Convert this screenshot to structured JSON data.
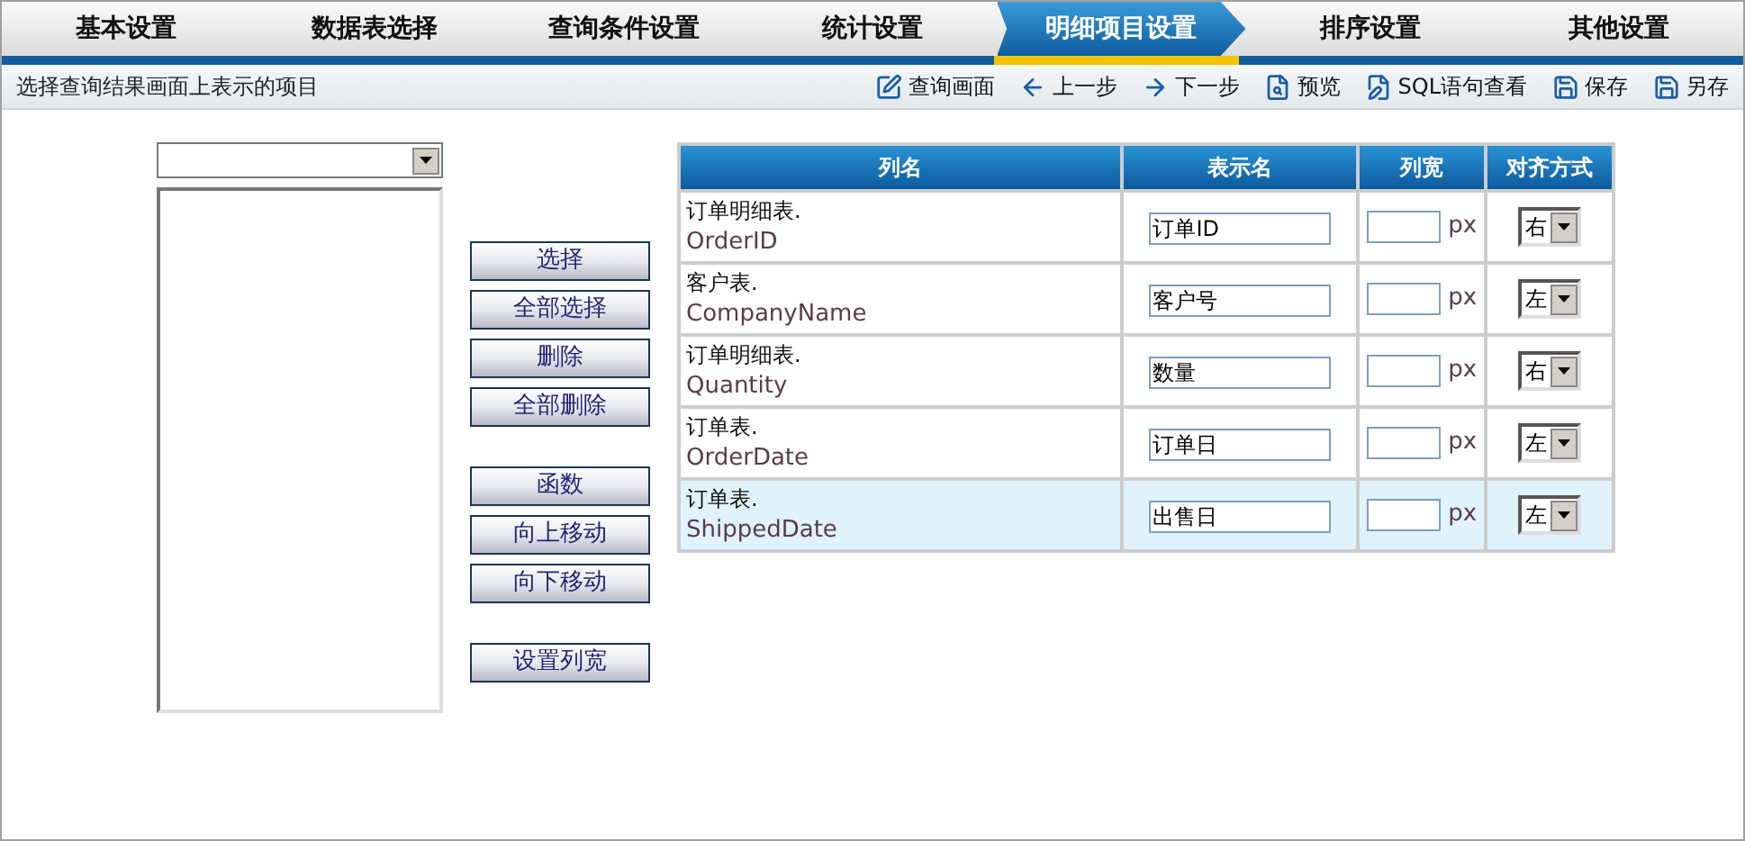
{
  "tabs": [
    {
      "label": "基本设置",
      "selected": false
    },
    {
      "label": "数据表选择",
      "selected": false
    },
    {
      "label": "查询条件设置",
      "selected": false
    },
    {
      "label": "统计设置",
      "selected": false
    },
    {
      "label": "明细项目设置",
      "selected": true
    },
    {
      "label": "排序设置",
      "selected": false
    },
    {
      "label": "其他设置",
      "selected": false
    }
  ],
  "toolbar": {
    "description": "选择查询结果画面上表示的项目",
    "actions": [
      {
        "kind": "query",
        "label": "查询画面"
      },
      {
        "kind": "prev",
        "label": "上一步"
      },
      {
        "kind": "next",
        "label": "下一步"
      },
      {
        "kind": "preview",
        "label": "预览"
      },
      {
        "kind": "sql",
        "label": "SQL语句查看"
      },
      {
        "kind": "save",
        "label": "保存"
      },
      {
        "kind": "saveas",
        "label": "另存"
      }
    ]
  },
  "button_groups": [
    [
      "选择",
      "全部选择",
      "删除",
      "全部删除"
    ],
    [
      "函数",
      "向上移动",
      "向下移动"
    ],
    [
      "设置列宽"
    ]
  ],
  "table": {
    "columns": [
      "列名",
      "表示名",
      "列宽",
      "对齐方式"
    ],
    "rows": [
      {
        "table_name": "订单明细表.",
        "column_name": "OrderID",
        "display_name": "订单ID",
        "unit": "px",
        "align": "右",
        "selected": false
      },
      {
        "table_name": "客户表.",
        "column_name": "CompanyName",
        "display_name": "客户号",
        "unit": "px",
        "align": "左",
        "selected": false
      },
      {
        "table_name": "订单明细表.",
        "column_name": "Quantity",
        "display_name": "数量",
        "unit": "px",
        "align": "右",
        "selected": false
      },
      {
        "table_name": "订单表.",
        "column_name": "OrderDate",
        "display_name": "订单日",
        "unit": "px",
        "align": "左",
        "selected": false
      },
      {
        "table_name": "订单表.",
        "column_name": "ShippedDate",
        "display_name": "出售日",
        "unit": "px",
        "align": "左",
        "selected": true
      }
    ]
  }
}
